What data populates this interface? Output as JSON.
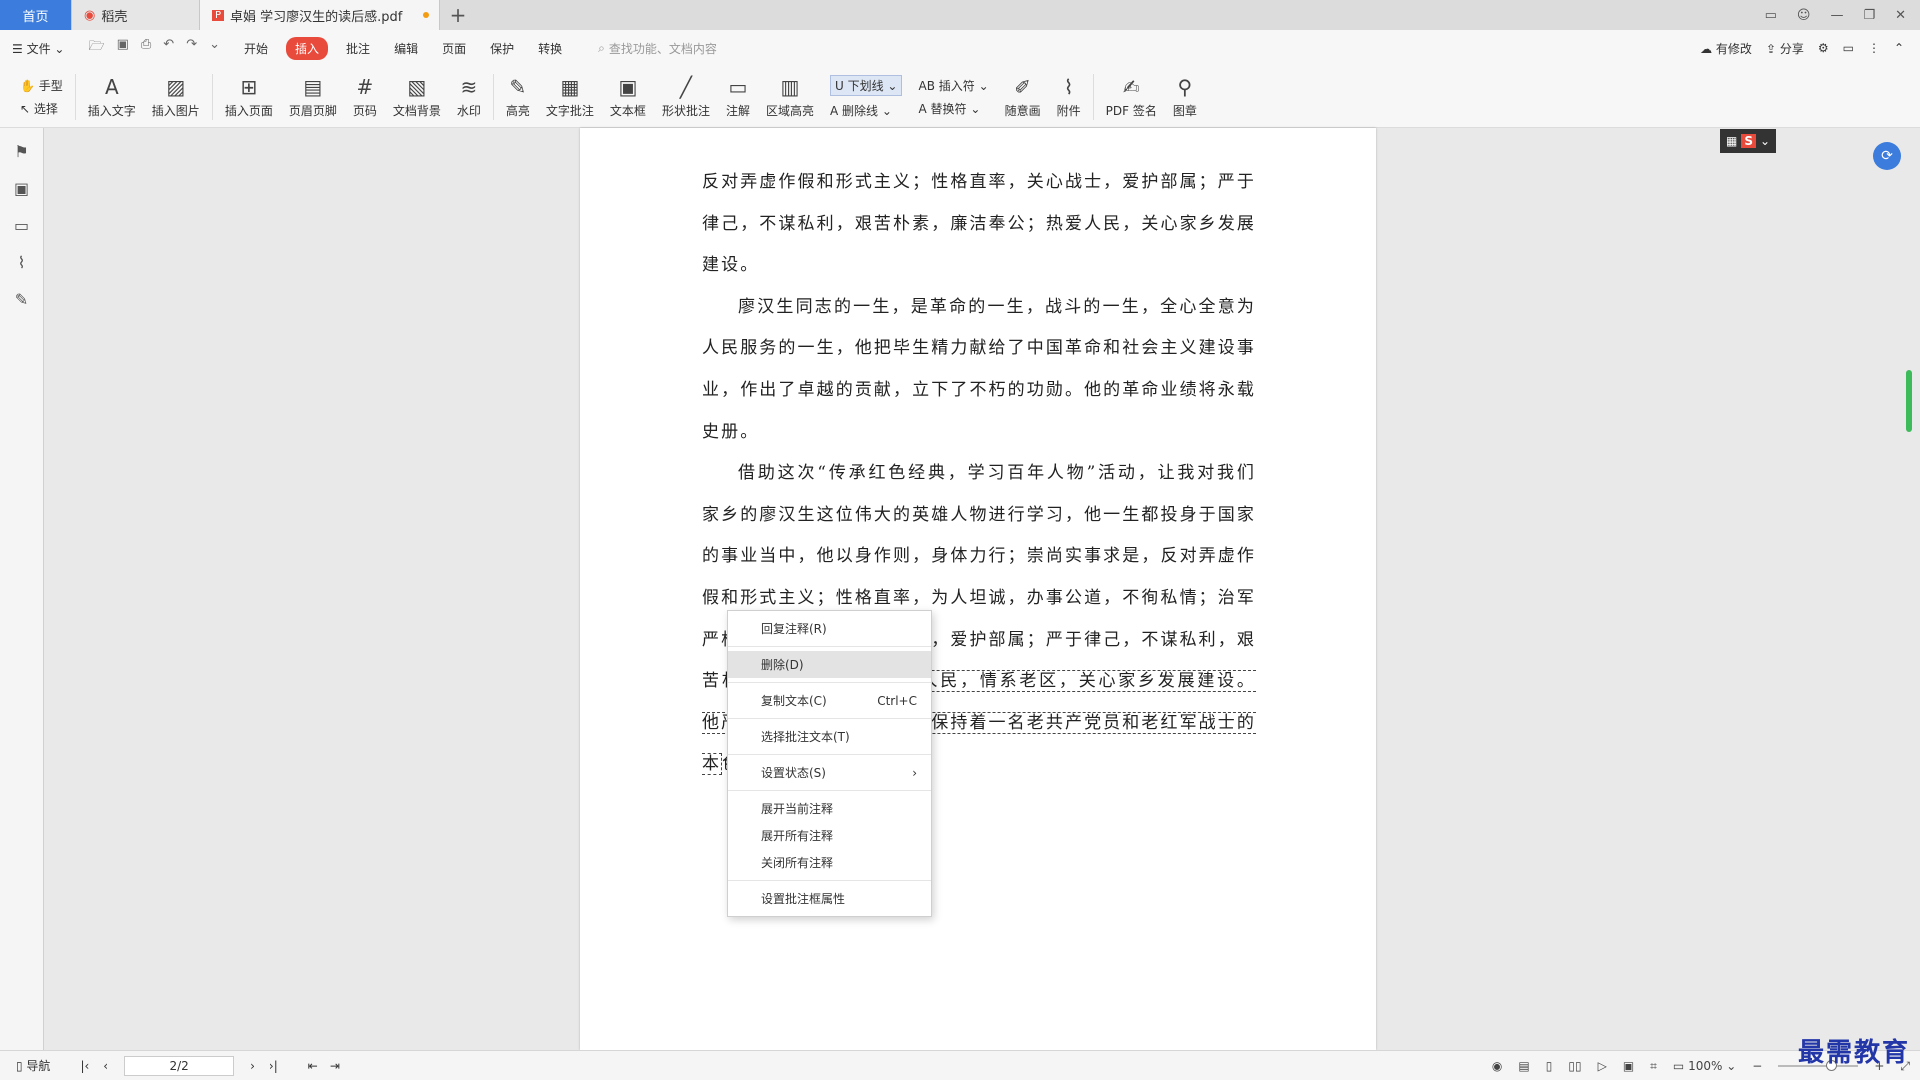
{
  "tabs": {
    "home": "首页",
    "straw": "稻壳",
    "doc": "卓娟 学习廖汉生的读后感.pdf",
    "add": "+"
  },
  "menu": {
    "file": "文件",
    "items": [
      "开始",
      "插入",
      "批注",
      "编辑",
      "页面",
      "保护",
      "转换"
    ],
    "active_index": 1,
    "search_placeholder": "查找功能、文档内容",
    "modified": "有修改",
    "share": "分享"
  },
  "ribbon": {
    "hand": "手型",
    "select": "选择",
    "buttons": [
      "插入文字",
      "插入图片",
      "插入页面",
      "页眉页脚",
      "页码",
      "文档背景",
      "水印",
      "高亮",
      "文字批注",
      "文本框",
      "形状批注",
      "注解",
      "区域高亮"
    ],
    "underline": "下划线",
    "insert_char": "插入符",
    "strike": "删除线",
    "replace": "替换符",
    "buttons2": [
      "随意画",
      "附件",
      "PDF 签名",
      "图章"
    ]
  },
  "document": {
    "paragraphs": [
      "反对弄虚作假和形式主义；性格直率，关心战士，爱护部属；严于律己，不谋私利，艰苦朴素，廉洁奉公；热爱人民，关心家乡发展建设。",
      "廖汉生同志的一生，是革命的一生，战斗的一生，全心全意为人民服务的一生，他把毕生精力献给了中国革命和社会主义建设事业，作出了卓越的贡献，立下了不朽的功勋。他的革命业绩将永载史册。",
      "借助这次“传承红色经典，学习百年人物”活动，让我对我们家乡的廖汉生这位伟大的英雄人物进行学习，他一生都投身于国家的事业当中，他以身作则，身体力行；崇尚实事求是，反对弄虚作假和形式主义；性格直率，为人坦诚，办事公道，不徇私情；治军严格，铁面无私，关心战士，爱护部属；严于律己，不谋私利，艰苦朴素，廉"
    ],
    "annotated": "洁奉公；热爱人民，情系老区，关心家乡发展建设。他严格要求子女亲属，始终保持着一名老共产党员和老红军战士的本",
    "tail": "色。"
  },
  "context_menu": {
    "items": [
      {
        "label": "回复注释(R)",
        "shortcut": ""
      },
      {
        "label": "删除(D)",
        "shortcut": ""
      },
      {
        "label": "复制文本(C)",
        "shortcut": "Ctrl+C"
      },
      {
        "label": "选择批注文本(T)",
        "shortcut": ""
      },
      {
        "label": "设置状态(S)",
        "shortcut": "›"
      },
      {
        "label": "展开当前注释",
        "shortcut": ""
      },
      {
        "label": "展开所有注释",
        "shortcut": ""
      },
      {
        "label": "关闭所有注释",
        "shortcut": ""
      },
      {
        "label": "设置批注框属性",
        "shortcut": ""
      }
    ]
  },
  "status": {
    "nav": "导航",
    "page": "2/2",
    "zoom": "100%",
    "watermark": "最需教育"
  },
  "colors": {
    "accent": "#3c7cdc",
    "active_menu": "#e84a3c",
    "scroll": "#3dbb5a"
  }
}
